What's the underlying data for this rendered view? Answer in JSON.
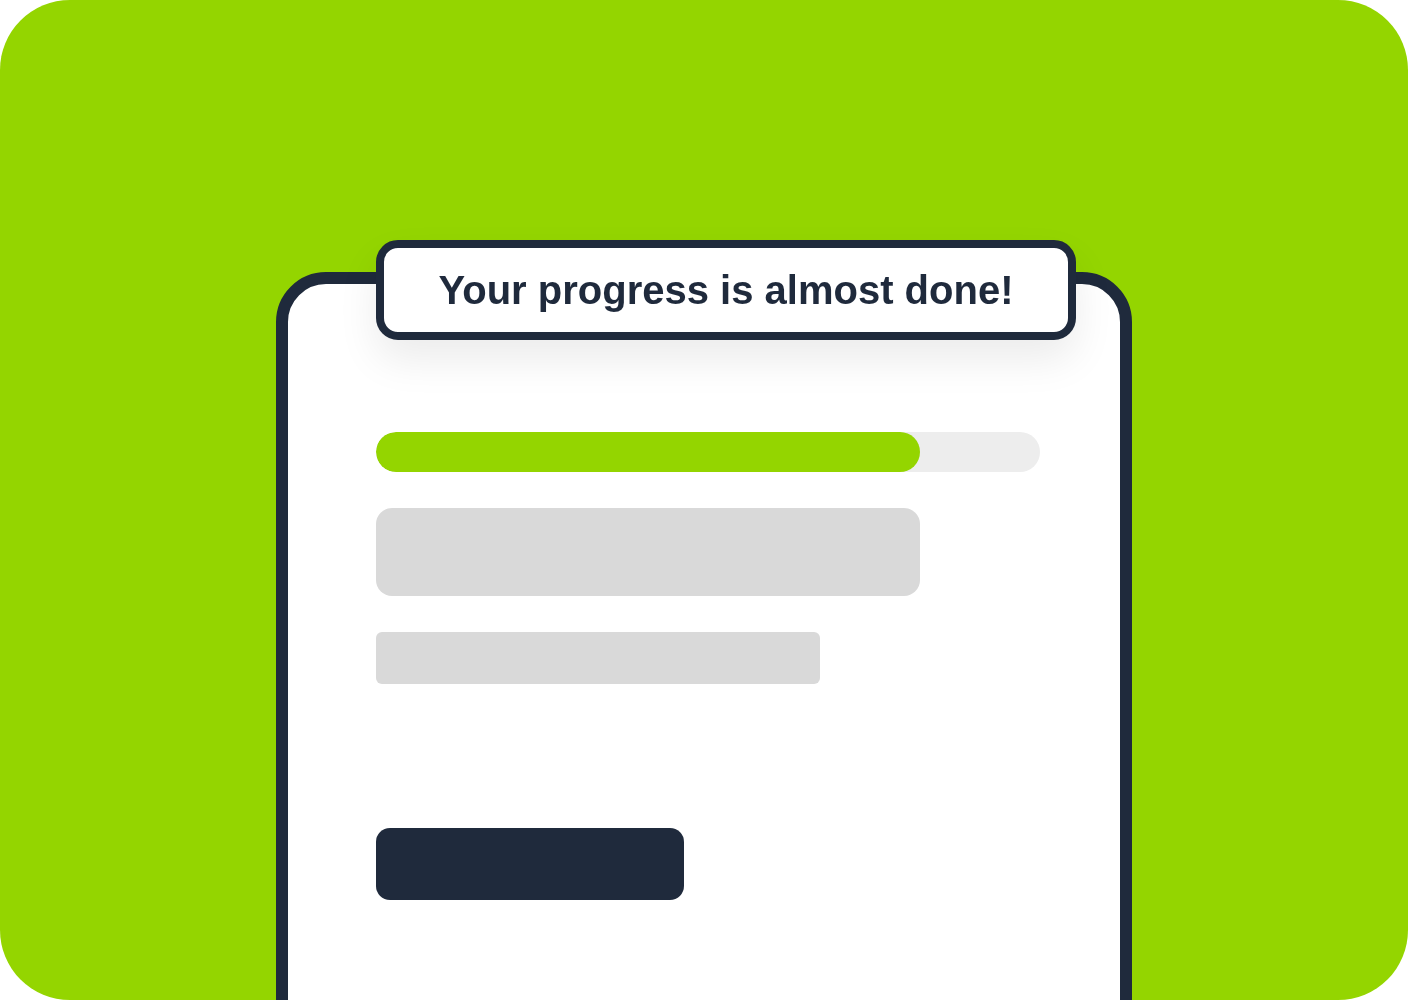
{
  "banner": {
    "text": "Your progress is almost done!"
  },
  "progress": {
    "level": 0.82
  }
}
